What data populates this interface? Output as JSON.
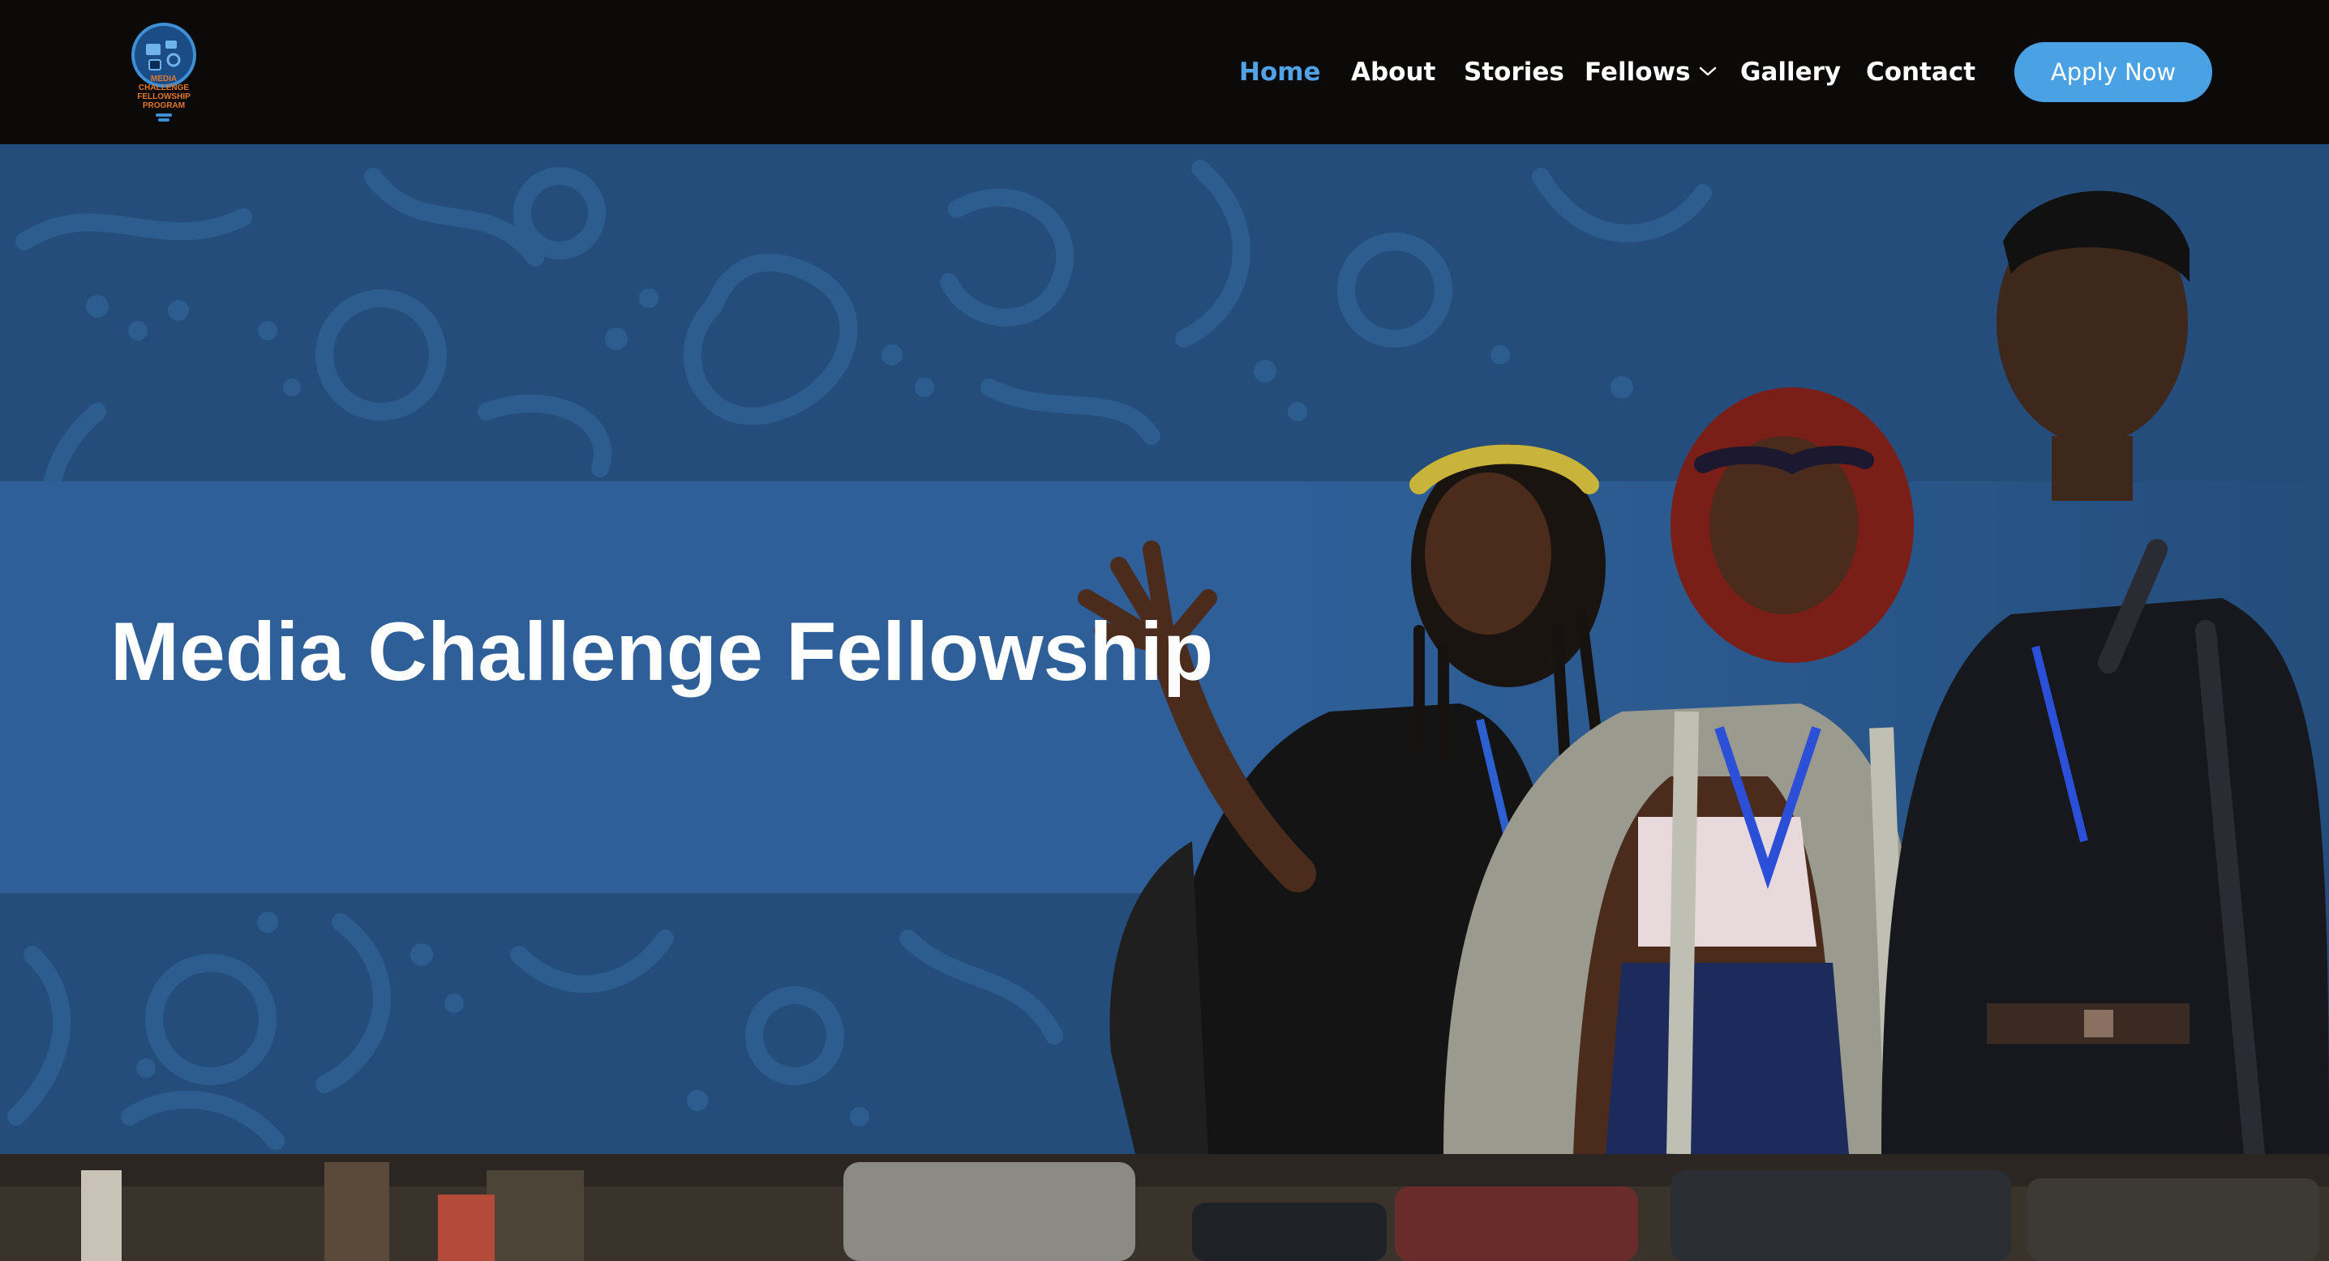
{
  "header": {
    "logo": {
      "lines": [
        "MEDIA",
        "CHALLENGE",
        "FELLOWSHIP",
        "PROGRAM"
      ],
      "icon": "lightbulb-icon"
    },
    "nav": {
      "items": [
        {
          "label": "Home",
          "active": true
        },
        {
          "label": "About",
          "active": false
        },
        {
          "label": "Stories",
          "active": false
        },
        {
          "label": "Fellows",
          "active": false,
          "has_dropdown": true
        },
        {
          "label": "Gallery",
          "active": false
        },
        {
          "label": "Contact",
          "active": false
        }
      ]
    },
    "cta": {
      "label": "Apply Now"
    }
  },
  "hero": {
    "title": "Media Challenge Fellowship"
  },
  "colors": {
    "header_bg": "#0b0a09",
    "accent": "#4aa2e4",
    "active_nav": "#4fa3e6",
    "hero_bg": "#244d7b",
    "hero_band": "#2e5f98"
  }
}
